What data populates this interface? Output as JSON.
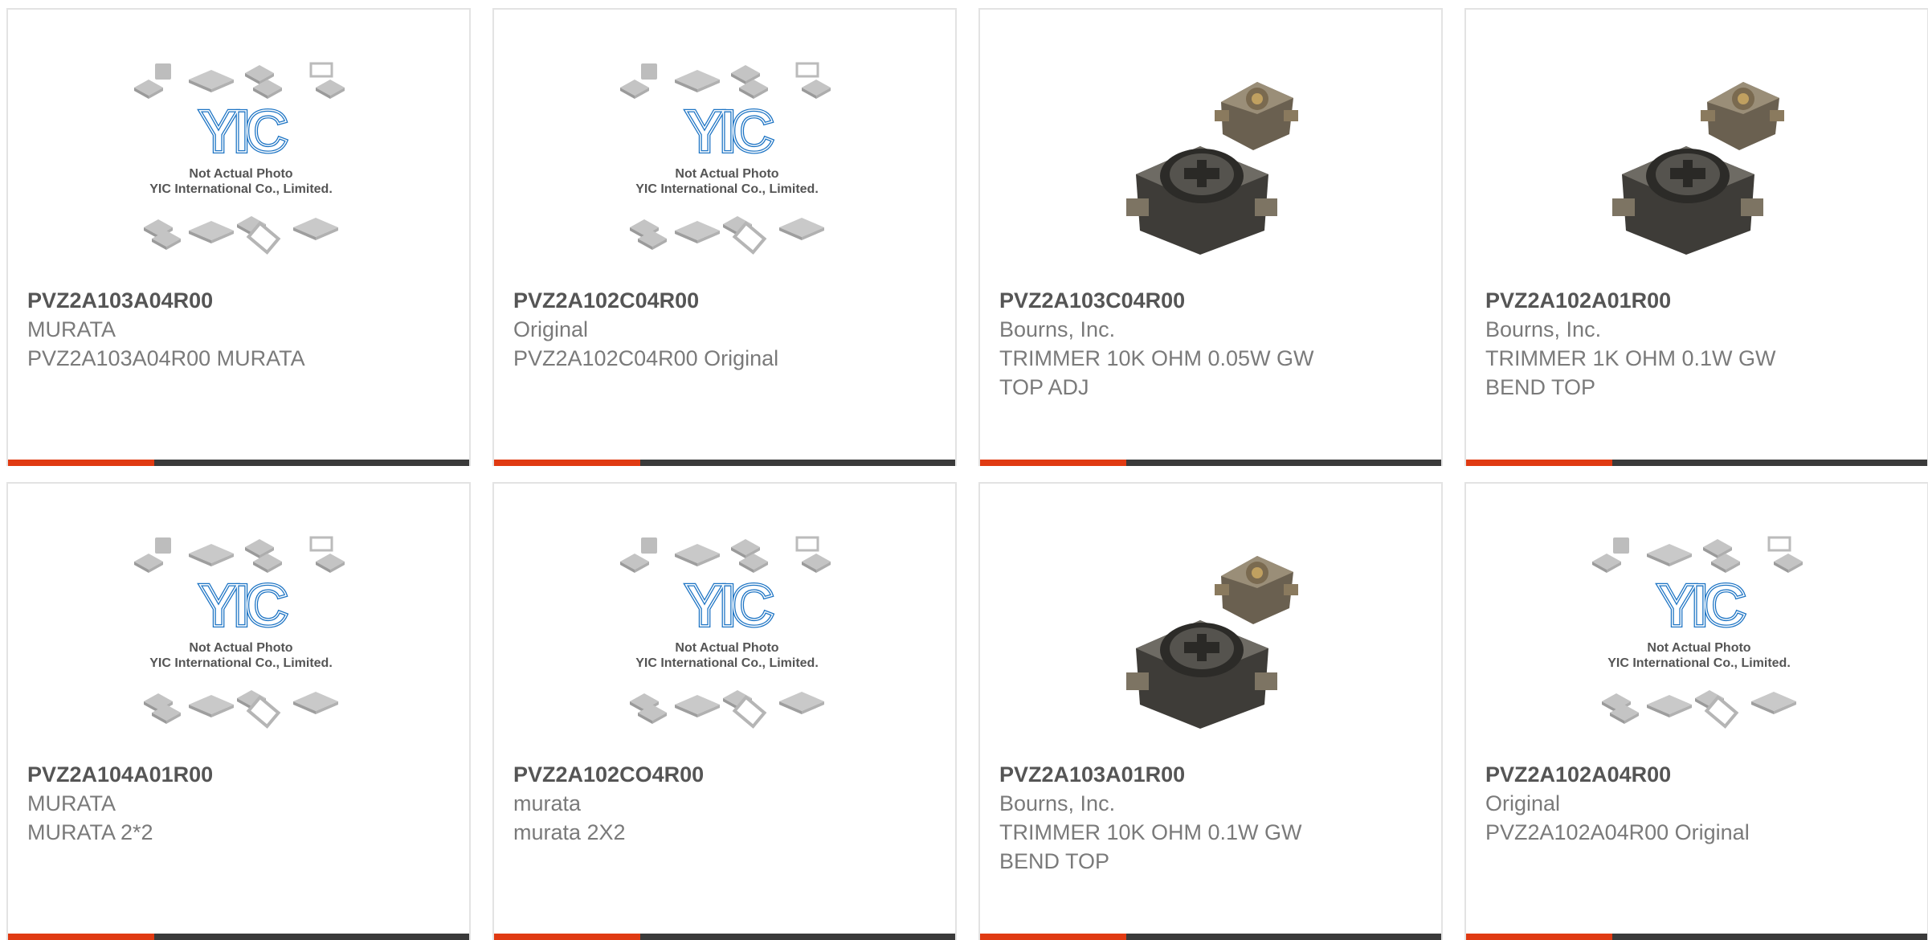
{
  "placeholder_caption": {
    "line1": "Not Actual Photo",
    "line2": "YIC International Co., Limited."
  },
  "placeholder_logo_text": "YIC",
  "colors": {
    "accent": "#e03a12",
    "bar": "#3a3a3a",
    "logo_blue": "#1d74c4"
  },
  "products": [
    {
      "part": "PVZ2A103A04R00",
      "manufacturer": "MURATA",
      "description": "PVZ2A103A04R00 MURATA",
      "image": "yic-placeholder-icon"
    },
    {
      "part": "PVZ2A102C04R00",
      "manufacturer": "Original",
      "description": "PVZ2A102C04R00 Original",
      "image": "yic-placeholder-icon"
    },
    {
      "part": "PVZ2A103C04R00",
      "manufacturer": "Bourns, Inc.",
      "description": "TRIMMER 10K OHM 0.05W GW TOP ADJ",
      "image": "trimmer-potentiometer-photo"
    },
    {
      "part": "PVZ2A102A01R00",
      "manufacturer": "Bourns, Inc.",
      "description": "TRIMMER 1K OHM 0.1W GW BEND TOP",
      "image": "trimmer-potentiometer-photo"
    },
    {
      "part": "PVZ2A104A01R00",
      "manufacturer": "MURATA",
      "description": "MURATA 2*2",
      "image": "yic-placeholder-icon"
    },
    {
      "part": "PVZ2A102CO4R00",
      "manufacturer": "murata",
      "description": "murata 2X2",
      "image": "yic-placeholder-icon"
    },
    {
      "part": "PVZ2A103A01R00",
      "manufacturer": "Bourns, Inc.",
      "description": "TRIMMER 10K OHM 0.1W GW BEND TOP",
      "image": "trimmer-potentiometer-photo"
    },
    {
      "part": "PVZ2A102A04R00",
      "manufacturer": "Original",
      "description": "PVZ2A102A04R00 Original",
      "image": "yic-placeholder-icon"
    }
  ]
}
